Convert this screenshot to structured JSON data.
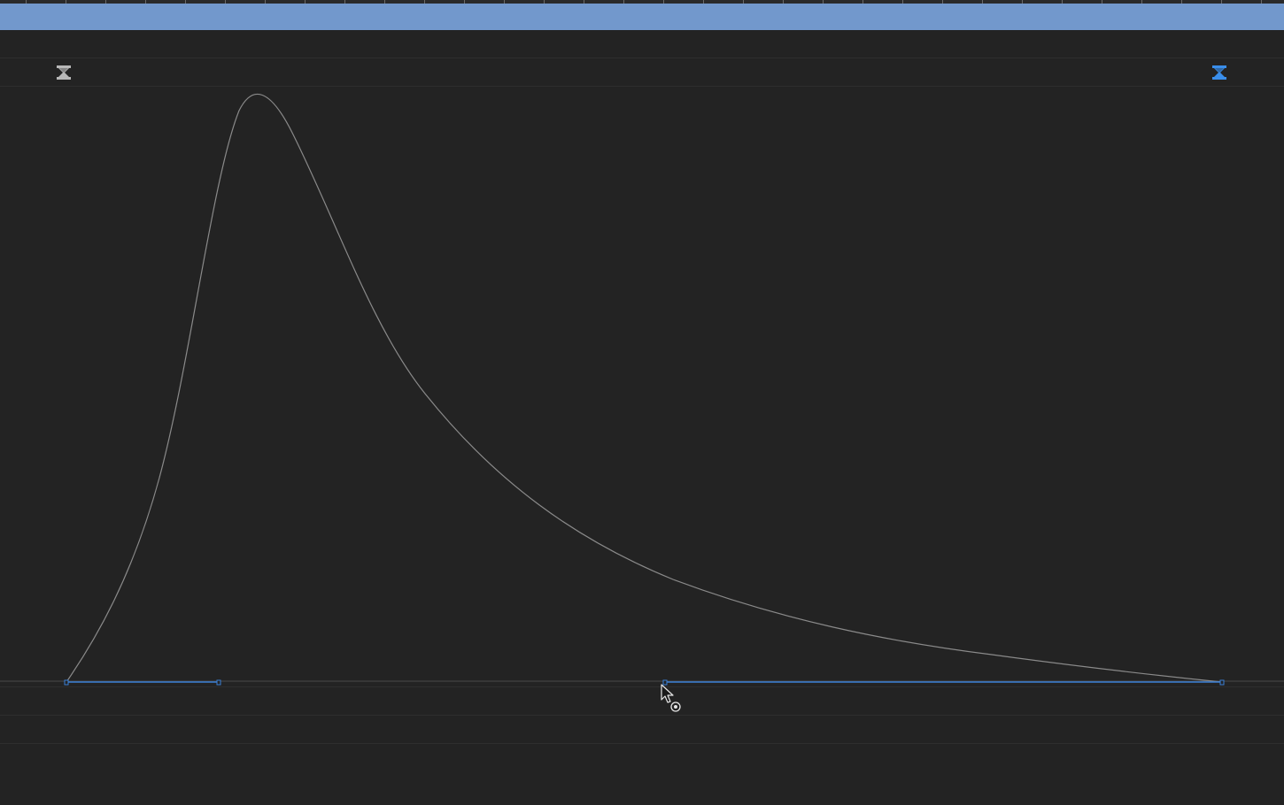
{
  "timeline": {
    "work_area": {
      "color": "#7298cc"
    },
    "markers": [
      {
        "name": "in-point-marker-icon",
        "color": "#b8b8b8",
        "state": "inactive"
      },
      {
        "name": "out-point-marker-icon",
        "color": "#3a8eea",
        "state": "active"
      }
    ]
  },
  "graph_editor": {
    "curve_color": "#8a8a8a",
    "handle_color": "#3a7fd6",
    "baseline_color": "#555555",
    "cursor_icon": "keyframe-select-cursor-icon"
  }
}
